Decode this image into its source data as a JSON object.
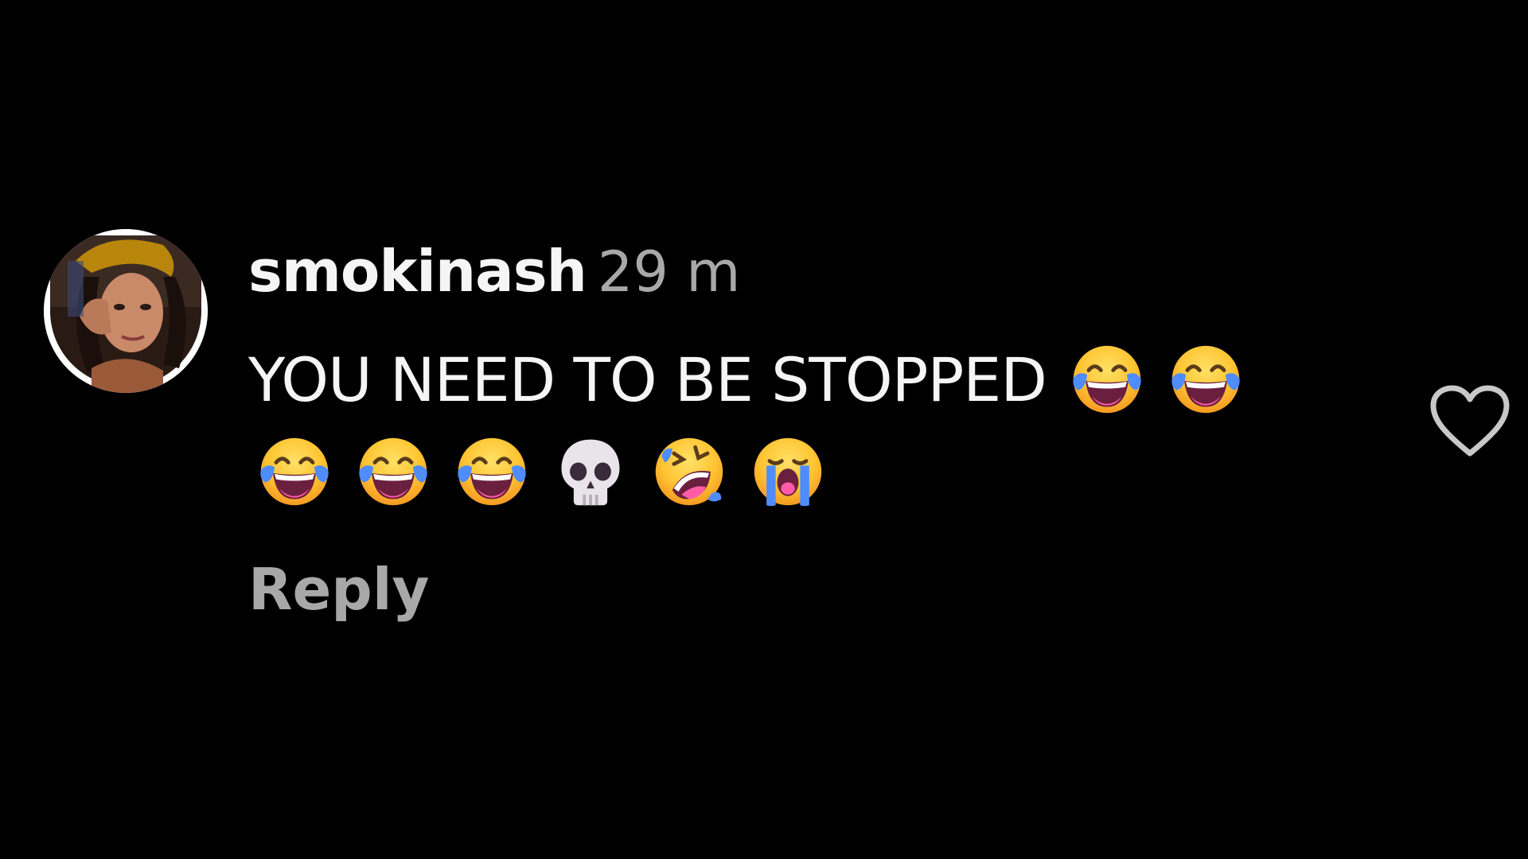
{
  "comment": {
    "username": "smokinash",
    "timestamp": "29 m",
    "text": "YOU NEED TO BE STOPPED",
    "emojis_line1": [
      "face-with-tears-of-joy",
      "face-with-tears-of-joy"
    ],
    "emojis_line2": [
      "face-with-tears-of-joy",
      "face-with-tears-of-joy",
      "face-with-tears-of-joy",
      "skull",
      "rolling-on-the-floor-laughing",
      "loudly-crying-face"
    ],
    "reply_label": "Reply",
    "like_icon": "heart-outline-icon"
  },
  "colors": {
    "background": "#000000",
    "primary_text": "#f5f5f5",
    "secondary_text": "#a8a8a8"
  }
}
